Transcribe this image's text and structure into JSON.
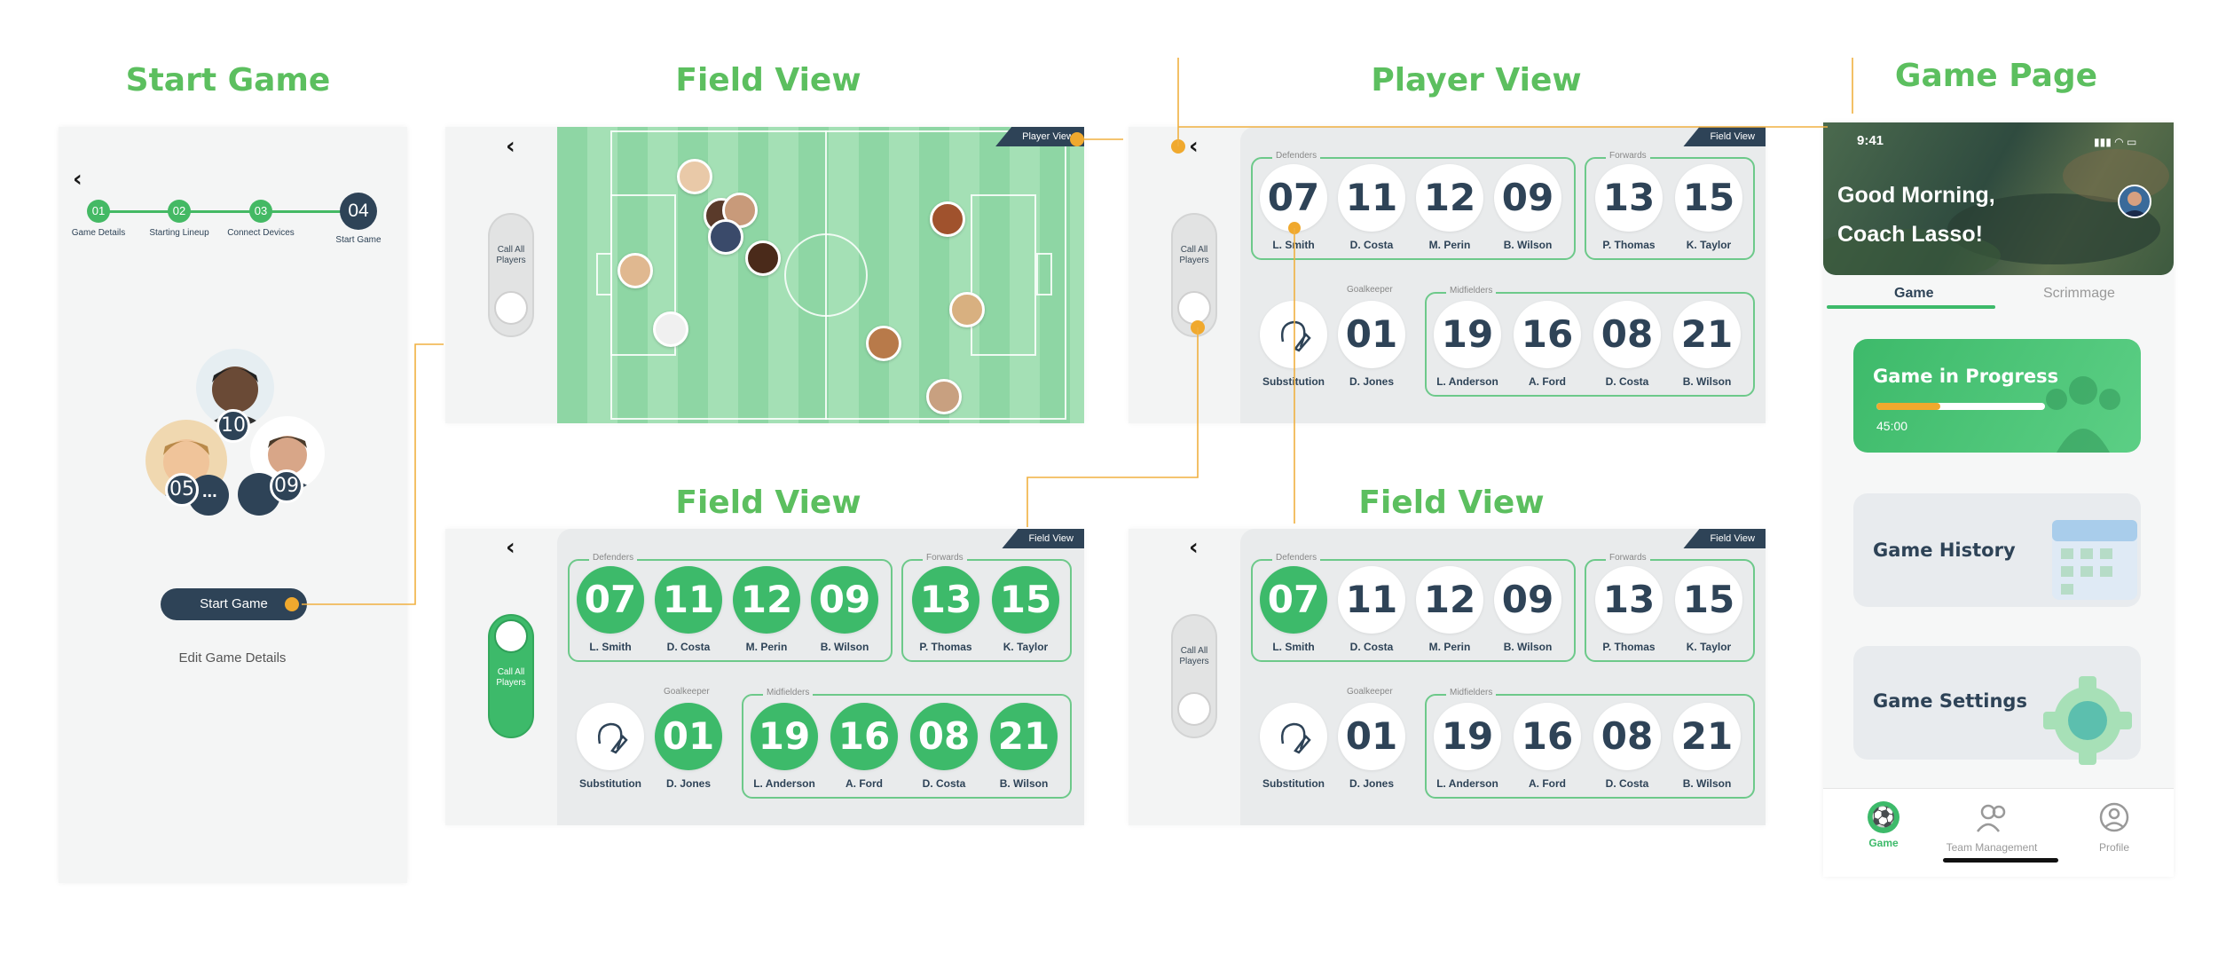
{
  "titles": {
    "start_game": "Start Game",
    "field_view": "Field View",
    "player_view": "Player View",
    "game_page": "Game Page",
    "field_view_2": "Field View",
    "field_view_3": "Field View"
  },
  "start_game": {
    "steps": [
      {
        "num": "01",
        "label": "Game Details"
      },
      {
        "num": "02",
        "label": "Starting Lineup"
      },
      {
        "num": "03",
        "label": "Connect Devices"
      },
      {
        "num": "04",
        "label": "Start Game"
      }
    ],
    "badges": [
      "10",
      "05",
      "09",
      "..."
    ],
    "start_button": "Start Game",
    "edit_link": "Edit Game Details"
  },
  "toggle_label": "Call All Players",
  "tags": {
    "player_view": "Player View",
    "field_view": "Field View"
  },
  "roster": {
    "defenders_label": "Defenders",
    "forwards_label": "Forwards",
    "goalkeeper_label": "Goalkeeper",
    "midfielders_label": "Midfielders",
    "defenders": [
      {
        "num": "07",
        "name": "L. Smith"
      },
      {
        "num": "11",
        "name": "D. Costa"
      },
      {
        "num": "12",
        "name": "M. Perin"
      },
      {
        "num": "09",
        "name": "B. Wilson"
      }
    ],
    "forwards": [
      {
        "num": "13",
        "name": "P. Thomas"
      },
      {
        "num": "15",
        "name": "K. Taylor"
      }
    ],
    "substitution": "Substitution",
    "goalkeeper": {
      "num": "01",
      "name": "D. Jones"
    },
    "midfielders": [
      {
        "num": "19",
        "name": "L. Anderson"
      },
      {
        "num": "16",
        "name": "A. Ford"
      },
      {
        "num": "08",
        "name": "D. Costa"
      },
      {
        "num": "21",
        "name": "B. Wilson"
      }
    ]
  },
  "game_page": {
    "time": "9:41",
    "greeting_line1": "Good Morning,",
    "greeting_line2": "Coach Lasso!",
    "tabs": [
      "Game",
      "Scrimmage"
    ],
    "card_progress": {
      "title": "Game in Progress",
      "time": "45:00",
      "progress": 0.38
    },
    "card_history": "Game History",
    "card_settings": "Game Settings",
    "nav": [
      "Game",
      "Team Management",
      "Profile"
    ]
  },
  "colors": {
    "green": "#3dba6a",
    "navy": "#2e4357",
    "accent": "#f0a92e",
    "title_green": "#5cbf5f"
  }
}
